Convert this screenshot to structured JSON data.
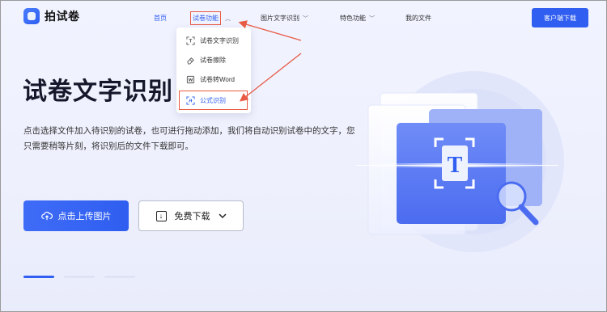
{
  "brand": {
    "name": "拍试卷"
  },
  "nav": {
    "items": [
      {
        "label": "首页"
      },
      {
        "label": "试卷功能"
      },
      {
        "label": "图片文字识别"
      },
      {
        "label": "特色功能"
      },
      {
        "label": "我的文件"
      }
    ],
    "download_label": "客户端下载"
  },
  "dropdown": {
    "items": [
      {
        "label": "试卷文字识别",
        "icon": "scan-text-icon"
      },
      {
        "label": "试卷擦除",
        "icon": "eraser-icon"
      },
      {
        "label": "试卷转Word",
        "icon": "word-icon"
      },
      {
        "label": "公式识别",
        "icon": "formula-icon"
      }
    ]
  },
  "hero": {
    "title": "试卷文字识别",
    "description": "点击选择文件加入待识别的试卷，也可进行拖动添加，我们将自动识别试卷中的文字，您只需要稍等片刻，将识别后的文件下载即可。",
    "upload_label": "点击上传图片",
    "free_download_label": "免费下载"
  },
  "illustration": {
    "glyph": "T"
  },
  "colors": {
    "accent": "#2f5ef0",
    "annotation": "#e85b45"
  }
}
